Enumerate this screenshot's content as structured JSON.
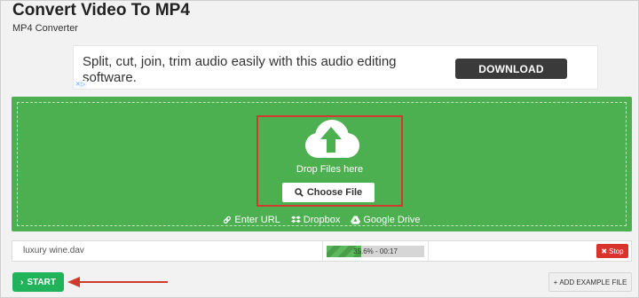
{
  "page": {
    "title": "Convert Video To MP4",
    "subtitle": "MP4 Converter"
  },
  "ad": {
    "text": "Split, cut, join, trim audio easily with this audio editing software.",
    "button_label": "DOWNLOAD",
    "badge": "✕▷"
  },
  "dropzone": {
    "icon": "cloud-upload-icon",
    "label": "Drop Files here",
    "choose_label": "Choose File",
    "sources": [
      {
        "icon": "link-icon",
        "label": "Enter URL"
      },
      {
        "icon": "dropbox-icon",
        "label": "Dropbox"
      },
      {
        "icon": "google-drive-icon",
        "label": "Google Drive"
      }
    ]
  },
  "file": {
    "name": "luxury wine.dav",
    "progress_percent": 35.6,
    "progress_text": "35.6% - 00:17",
    "stop_label": "Stop"
  },
  "actions": {
    "start_label": "START",
    "example_label": "ADD EXAMPLE FILE"
  },
  "colors": {
    "accent_green": "#4caf50",
    "start_green": "#21b35a",
    "stop_red": "#d9342b",
    "highlight_red": "#d03a2e",
    "ad_button": "#3a3a3a"
  }
}
